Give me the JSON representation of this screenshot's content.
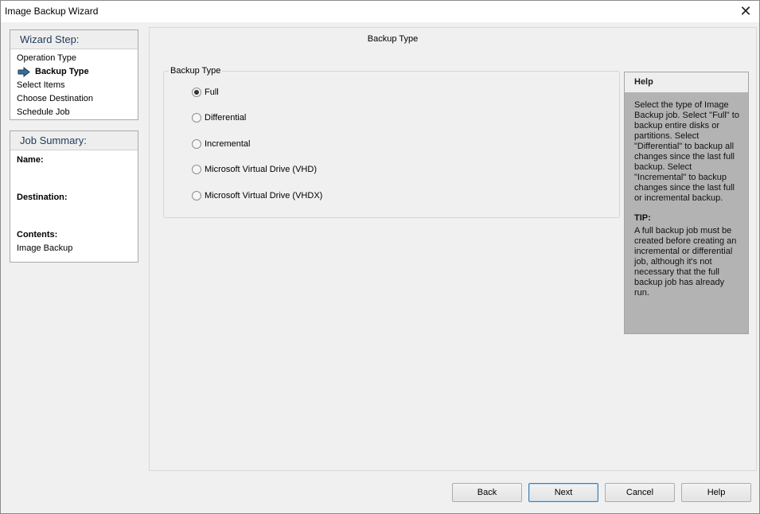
{
  "window": {
    "title": "Image Backup Wizard",
    "close_glyph": "✕"
  },
  "wizard_step": {
    "heading": "Wizard Step:",
    "items": [
      {
        "label": "Operation Type",
        "active": false
      },
      {
        "label": "Backup Type",
        "active": true
      },
      {
        "label": "Select Items",
        "active": false
      },
      {
        "label": "Choose Destination",
        "active": false
      },
      {
        "label": "Schedule Job",
        "active": false
      }
    ]
  },
  "job_summary": {
    "heading": "Job Summary:",
    "name_label": "Name:",
    "name_value": "",
    "destination_label": "Destination:",
    "destination_value": "",
    "contents_label": "Contents:",
    "contents_value": "Image Backup"
  },
  "main": {
    "title": "Backup Type",
    "group_label": "Backup Type",
    "options": [
      {
        "label": "Full",
        "checked": true
      },
      {
        "label": "Differential",
        "checked": false
      },
      {
        "label": "Incremental",
        "checked": false
      },
      {
        "label": "Microsoft Virtual Drive (VHD)",
        "checked": false
      },
      {
        "label": "Microsoft Virtual Drive (VHDX)",
        "checked": false
      }
    ]
  },
  "help": {
    "heading": "Help",
    "text": "Select the type of Image Backup job.  Select \"Full\" to backup entire disks or partitions.  Select \"Differential\" to backup all changes since the last full backup.  Select \"Incremental\" to backup changes since the last full or incremental backup.",
    "tip_label": "TIP:",
    "tip_text": "A full backup job must be created before creating an incremental or differential job, although it's not necessary that the full backup job has already run."
  },
  "buttons": {
    "back": "Back",
    "next": "Next",
    "cancel": "Cancel",
    "help": "Help"
  },
  "colors": {
    "accent": "#1f3a5a",
    "help_background": "#b3b3b3",
    "arrow_icon": "#3a6d9a"
  }
}
